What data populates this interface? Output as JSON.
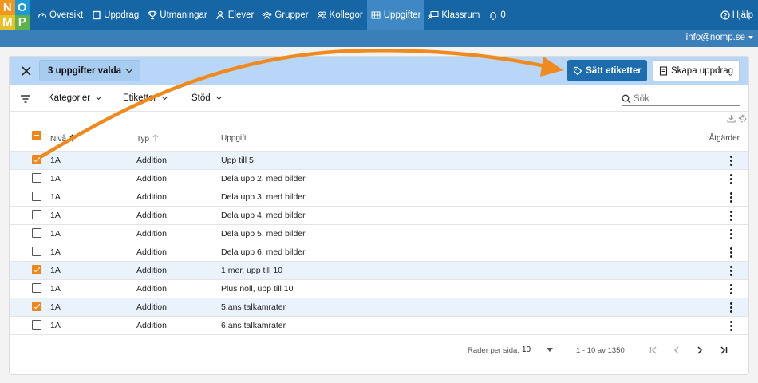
{
  "logo": {
    "letters": [
      "N",
      "O",
      "M",
      "P"
    ]
  },
  "nav": {
    "items": [
      {
        "label": "Översikt",
        "icon": "gauge-icon",
        "active": false
      },
      {
        "label": "Uppdrag",
        "icon": "book-icon",
        "active": false
      },
      {
        "label": "Utmaningar",
        "icon": "trophy-icon",
        "active": false
      },
      {
        "label": "Elever",
        "icon": "person-icon",
        "active": false
      },
      {
        "label": "Grupper",
        "icon": "group-icon",
        "active": false
      },
      {
        "label": "Kollegor",
        "icon": "people-icon",
        "active": false
      },
      {
        "label": "Uppgifter",
        "icon": "grid-icon",
        "active": true
      },
      {
        "label": "Klassrum",
        "icon": "classroom-icon",
        "active": false
      },
      {
        "label": "0",
        "icon": "bell-icon",
        "active": false
      }
    ],
    "help_label": "Hjälp",
    "user_email": "info@nomp.se"
  },
  "selection": {
    "count_label": "3 uppgifter valda",
    "set_tags_label": "Sätt etiketter",
    "create_task_label": "Skapa uppdrag"
  },
  "filters": {
    "categories_label": "Kategorier",
    "tags_label": "Etiketter",
    "support_label": "Stöd",
    "search_placeholder": "Sök"
  },
  "table": {
    "headers": {
      "level": "Nivå",
      "type": "Typ",
      "task": "Uppgift",
      "actions": "Åtgärder"
    },
    "rows": [
      {
        "level": "1A",
        "type": "Addition",
        "task": "Upp till 5",
        "checked": true
      },
      {
        "level": "1A",
        "type": "Addition",
        "task": "Dela upp 2, med bilder",
        "checked": false
      },
      {
        "level": "1A",
        "type": "Addition",
        "task": "Dela upp 3, med bilder",
        "checked": false
      },
      {
        "level": "1A",
        "type": "Addition",
        "task": "Dela upp 4, med bilder",
        "checked": false
      },
      {
        "level": "1A",
        "type": "Addition",
        "task": "Dela upp 5, med bilder",
        "checked": false
      },
      {
        "level": "1A",
        "type": "Addition",
        "task": "Dela upp 6, med bilder",
        "checked": false
      },
      {
        "level": "1A",
        "type": "Addition",
        "task": "1 mer, upp till 10",
        "checked": true
      },
      {
        "level": "1A",
        "type": "Addition",
        "task": "Plus noll, upp till 10",
        "checked": false
      },
      {
        "level": "1A",
        "type": "Addition",
        "task": "5:ans talkamrater",
        "checked": true
      },
      {
        "level": "1A",
        "type": "Addition",
        "task": "6:ans talkamrater",
        "checked": false
      }
    ]
  },
  "pagination": {
    "rows_per_page_label": "Rader per sida:",
    "rows_per_page_value": "10",
    "range_label": "1 - 10 av 1350"
  },
  "colors": {
    "nav_bg": "#1666a6",
    "accent_orange": "#f0851a",
    "selection_bar": "#b8d6f7",
    "primary_button": "#1d6cad"
  }
}
